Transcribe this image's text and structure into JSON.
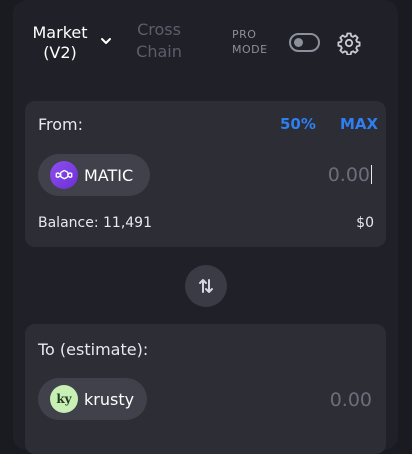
{
  "header": {
    "tab_market": "Market (V2)",
    "tab_cross": "Cross Chain",
    "pro_mode_label": "PRO MODE",
    "pro_mode_enabled": false,
    "icons": {
      "dropdown": "chevron-down-icon",
      "settings": "gear-icon"
    }
  },
  "from": {
    "label": "From:",
    "pct_50": "50%",
    "pct_max": "MAX",
    "token": {
      "symbol": "MATIC",
      "icon": "polygon-matic-icon"
    },
    "amount": "0.00",
    "balance": "Balance: 11,491",
    "usd_value": "$0"
  },
  "swap": {
    "icon": "swap-arrows-icon"
  },
  "to": {
    "label": "To (estimate):",
    "token": {
      "symbol": "krusty",
      "icon_text": "ky"
    },
    "amount": "0.00"
  },
  "colors": {
    "accent": "#2f7ff0",
    "background": "#1a1b20",
    "panel": "#202128",
    "card": "#2c2d35",
    "pill": "#40414b"
  }
}
